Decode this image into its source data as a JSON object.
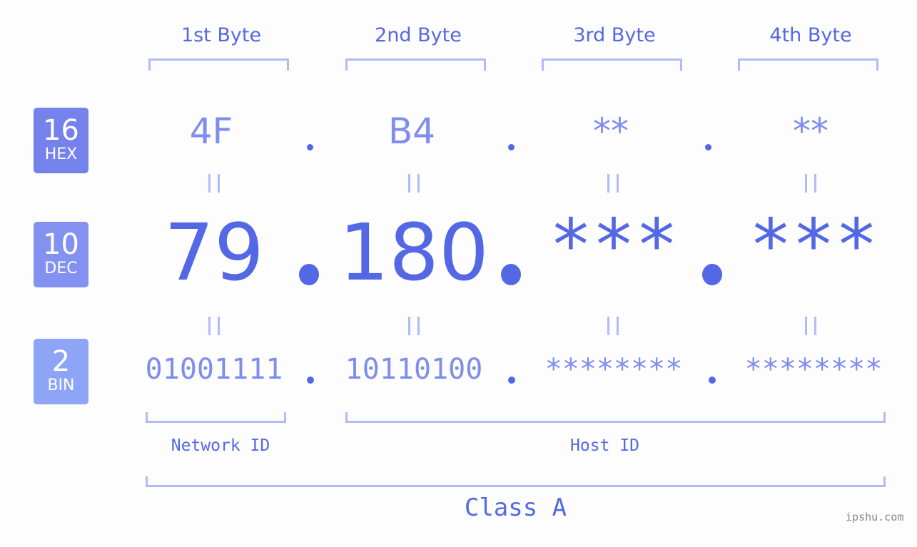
{
  "byte_headers": [
    "1st Byte",
    "2nd Byte",
    "3rd Byte",
    "4th Byte"
  ],
  "badges": {
    "hex": {
      "num": "16",
      "label": "HEX",
      "color": "#7582ec"
    },
    "dec": {
      "num": "10",
      "label": "DEC",
      "color": "#8392f0"
    },
    "bin": {
      "num": "2",
      "label": "BIN",
      "color": "#8ea5f7"
    }
  },
  "hex_values": [
    "4F",
    "B4",
    "**",
    "**"
  ],
  "dec_values": [
    "79",
    "180",
    "***",
    "***"
  ],
  "bin_values": [
    "01001111",
    "10110100",
    "********",
    "********"
  ],
  "equals_sign": "=",
  "network_label": "Network ID",
  "host_label": "Host ID",
  "class_label": "Class A",
  "brand": "ipshu.com",
  "colors": {
    "accent": "#5468e6",
    "light": "#7f8def",
    "bracket": "#b1bbf5"
  }
}
